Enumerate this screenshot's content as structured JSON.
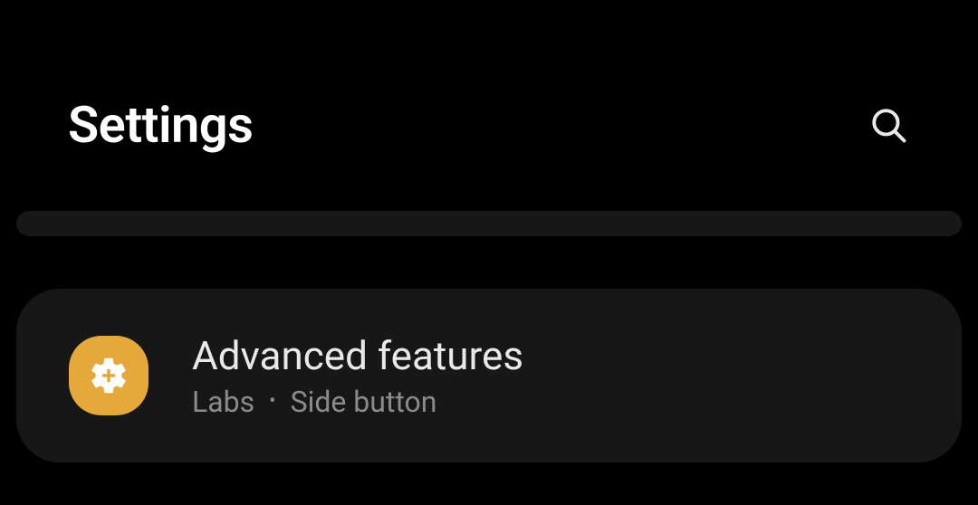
{
  "header": {
    "title": "Settings"
  },
  "list": {
    "items": [
      {
        "icon": "gear-plus-icon",
        "icon_bg": "#e5a93b",
        "title": "Advanced features",
        "subtitle_items": [
          "Labs",
          "Side button"
        ]
      }
    ]
  }
}
